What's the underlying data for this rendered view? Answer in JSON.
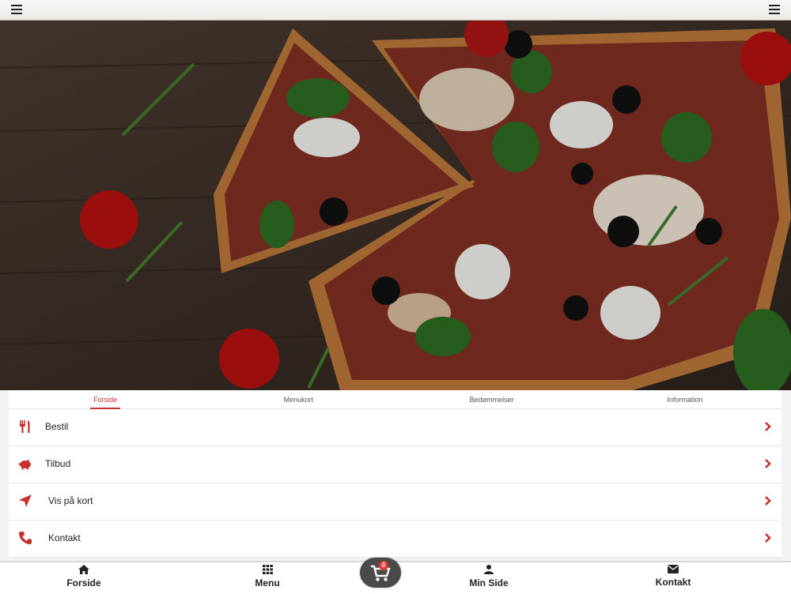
{
  "tabs": [
    {
      "label": "Forside",
      "active": true
    },
    {
      "label": "Menukort",
      "active": false
    },
    {
      "label": "Bedømmelser",
      "active": false
    },
    {
      "label": "Information",
      "active": false
    }
  ],
  "menu_rows": [
    {
      "label": "Bestil",
      "icon": "cutlery-icon"
    },
    {
      "label": "Tilbud",
      "icon": "piggy-bank-icon"
    },
    {
      "label": "Vis på kort",
      "icon": "location-arrow-icon"
    },
    {
      "label": "Kontakt",
      "icon": "phone-icon"
    }
  ],
  "bottom_nav": {
    "items": [
      {
        "label": "Forside",
        "icon": "home-icon"
      },
      {
        "label": "Menu",
        "icon": "grid-icon"
      },
      {
        "label": "Min Side",
        "icon": "user-icon"
      },
      {
        "label": "Kontakt",
        "icon": "envelope-icon"
      }
    ],
    "cart": {
      "count": "0",
      "icon": "shopping-cart-icon"
    }
  },
  "colors": {
    "accent": "#c9302c",
    "badge": "#e53935",
    "cart_button": "#4a4a4a"
  },
  "hero": {
    "image": "pizza-photo"
  }
}
